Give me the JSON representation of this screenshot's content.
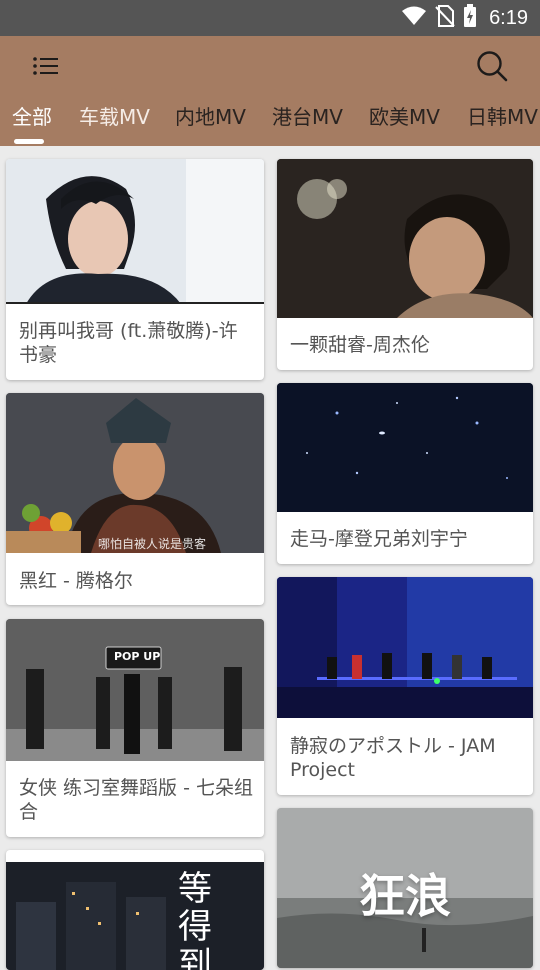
{
  "status_bar": {
    "time": "6:19",
    "icons": [
      "wifi-icon",
      "no-sim-icon",
      "battery-charging-icon"
    ]
  },
  "app_bar": {
    "background": "#a57c62",
    "menu_icon": "list-menu-icon",
    "search_icon": "search-icon"
  },
  "tabs": [
    {
      "label": "全部",
      "active": true
    },
    {
      "label": "车载MV",
      "active": false
    },
    {
      "label": "内地MV",
      "active": false
    },
    {
      "label": "港台MV",
      "active": false
    },
    {
      "label": "欧美MV",
      "active": false
    },
    {
      "label": "日韩MV",
      "active": false
    }
  ],
  "cards": [
    {
      "title": "别再叫我哥 (ft.萧敬腾)-许书豪"
    },
    {
      "title": "一颗甜睿-周杰伦"
    },
    {
      "title": "黑红 - 腾格尔",
      "thumb_caption": "哪怕自被人说是贵客"
    },
    {
      "title": "走马-摩登兄弟刘宇宁"
    },
    {
      "title": "女侠 练习室舞蹈版 - 七朵组合",
      "thumb_logo": "POP UP"
    },
    {
      "title": "静寂のアポストル - JAM Project"
    },
    {
      "title": "",
      "thumb_text": "等得到"
    },
    {
      "title": "",
      "thumb_text": "狂浪"
    }
  ]
}
